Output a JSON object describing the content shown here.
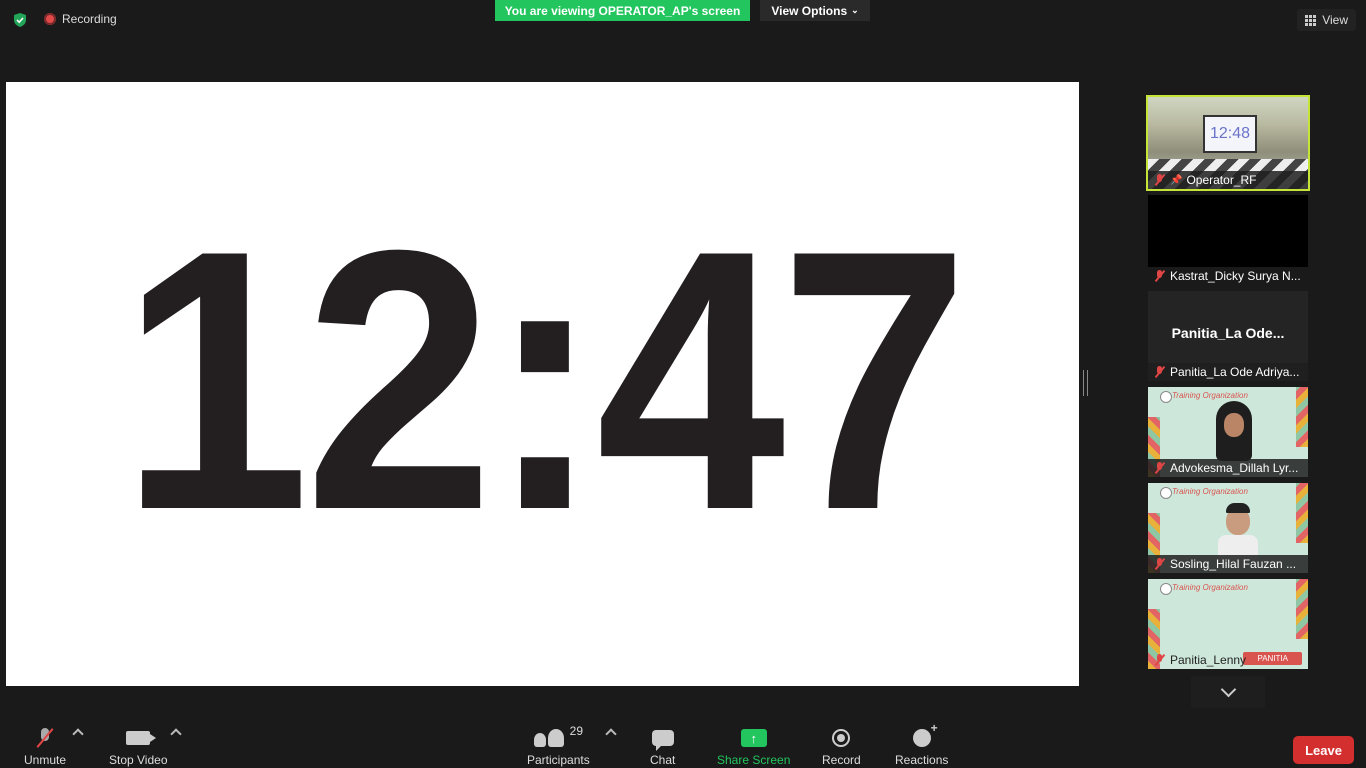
{
  "header": {
    "recording_label": "Recording",
    "viewing_banner": "You are viewing OPERATOR_AP's screen",
    "view_options_label": "View Options",
    "view_label": "View"
  },
  "shared_screen": {
    "clock_text": "12:47"
  },
  "participants": [
    {
      "name": "Operator_RF",
      "muted": true,
      "active": true,
      "thumb_clock": "12:48"
    },
    {
      "name": "Kastrat_Dicky Surya N...",
      "muted": true
    },
    {
      "name": "Panitia_La Ode Adriya...",
      "display_name": "Panitia_La  Ode...",
      "muted": true
    },
    {
      "name": "Advokesma_Dillah Lyr...",
      "muted": true,
      "background_text": "Training Organization"
    },
    {
      "name": "Sosling_Hilal Fauzan ...",
      "muted": true,
      "background_text": "Training Organization"
    },
    {
      "name": "Panitia_Lenny",
      "muted": true,
      "background_text": "Training Organization",
      "tag": "PANITIA"
    }
  ],
  "toolbar": {
    "unmute_label": "Unmute",
    "stop_video_label": "Stop Video",
    "participants_label": "Participants",
    "participants_count": "29",
    "chat_label": "Chat",
    "share_screen_label": "Share Screen",
    "record_label": "Record",
    "reactions_label": "Reactions",
    "leave_label": "Leave"
  },
  "colors": {
    "accent_green": "#22c55e",
    "leave_red": "#d32f2f",
    "active_speaker_border": "#c4e538"
  }
}
